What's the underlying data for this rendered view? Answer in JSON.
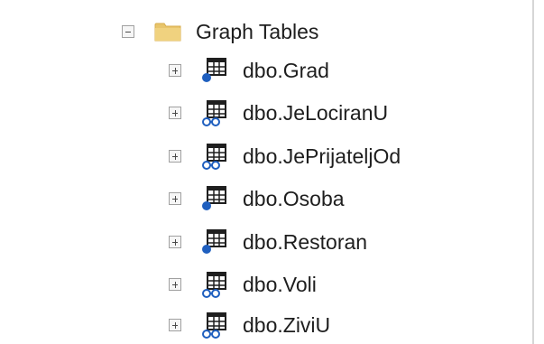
{
  "tree": {
    "folder": {
      "label": "Graph Tables",
      "icon": "folder-icon",
      "expanded": true
    },
    "items": [
      {
        "label": "dbo.Grad",
        "kind": "node",
        "icon": "node-table-icon",
        "expanded": false
      },
      {
        "label": "dbo.JeLociranU",
        "kind": "edge",
        "icon": "edge-table-icon",
        "expanded": false
      },
      {
        "label": "dbo.JePrijateljOd",
        "kind": "edge",
        "icon": "edge-table-icon",
        "expanded": false
      },
      {
        "label": "dbo.Osoba",
        "kind": "node",
        "icon": "node-table-icon",
        "expanded": false
      },
      {
        "label": "dbo.Restoran",
        "kind": "node",
        "icon": "node-table-icon",
        "expanded": false
      },
      {
        "label": "dbo.Voli",
        "kind": "edge",
        "icon": "edge-table-icon",
        "expanded": false
      },
      {
        "label": "dbo.ZiviU",
        "kind": "edge",
        "icon": "edge-table-icon",
        "expanded": false
      }
    ]
  },
  "colors": {
    "folder": "#e8c56b",
    "table_grid": "#1f1f1f",
    "node_dot": "#1f5fbf",
    "edge_links": "#1f5fbf",
    "expander_border": "#a0a0a0"
  }
}
